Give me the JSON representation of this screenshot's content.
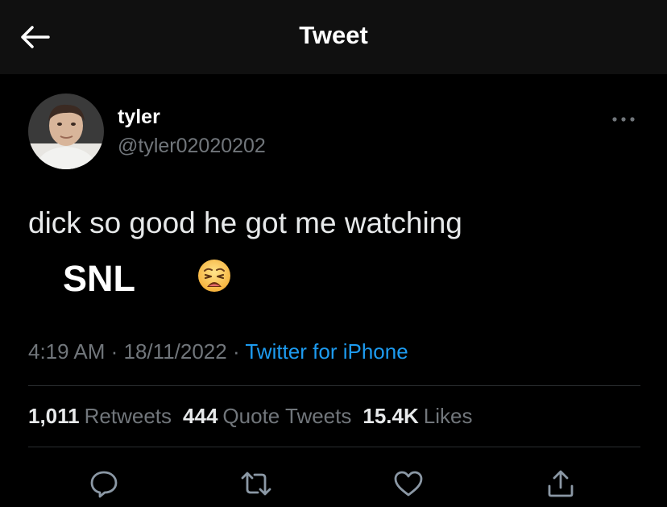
{
  "header": {
    "back_icon": "arrow-left-icon",
    "title": "Tweet"
  },
  "author": {
    "name": "tyler",
    "handle": "@tyler02020202",
    "avatar_icon": "profile-photo"
  },
  "tweet": {
    "text": "dick so good he got me watching",
    "overlay_text": "SNL",
    "emoji_icon": "weary-face-emoji"
  },
  "meta": {
    "time": "4:19 AM",
    "sep1": " · ",
    "date": "18/11/2022",
    "sep2": " · ",
    "source": "Twitter for iPhone"
  },
  "stats": {
    "retweets_count": "1,011",
    "retweets_label": "Retweets",
    "quotes_count": "444",
    "quotes_label": "Quote Tweets",
    "likes_count": "15.4K",
    "likes_label": "Likes"
  },
  "actions": {
    "reply_icon": "reply-icon",
    "retweet_icon": "retweet-icon",
    "like_icon": "heart-icon",
    "share_icon": "share-icon"
  },
  "colors": {
    "background": "#000000",
    "header_bg": "#101010",
    "text_primary": "#e7e9ea",
    "text_secondary": "#71767b",
    "link": "#1d9bf0"
  }
}
